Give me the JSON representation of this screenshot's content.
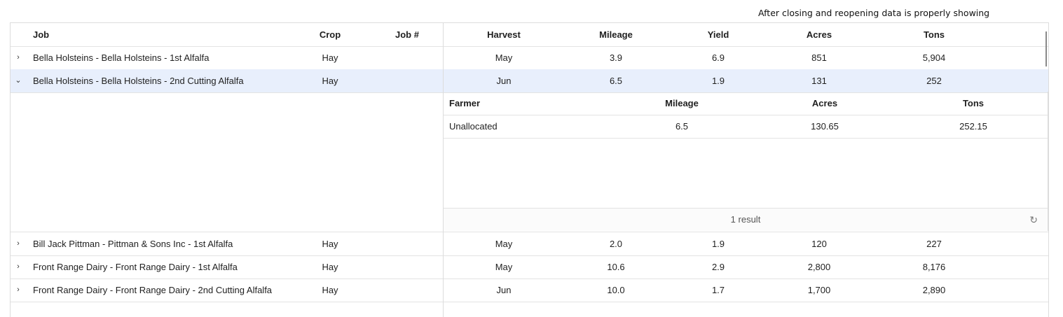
{
  "annotation": "After closing and reopening data is properly showing",
  "columns": {
    "job": "Job",
    "crop": "Crop",
    "job_no": "Job #",
    "harvest": "Harvest",
    "mileage": "Mileage",
    "yield": "Yield",
    "acres": "Acres",
    "tons": "Tons"
  },
  "rows": [
    {
      "expander": "›",
      "job": "Bella Holsteins - Bella Holsteins - 1st Alfalfa",
      "crop": "Hay",
      "job_no": "",
      "harvest": "May",
      "mileage": "3.9",
      "yield": "6.9",
      "acres": "851",
      "tons": "5,904"
    },
    {
      "expander": "⌄",
      "job": "Bella Holsteins - Bella Holsteins - 2nd Cutting Alfalfa",
      "crop": "Hay",
      "job_no": "",
      "harvest": "Jun",
      "mileage": "6.5",
      "yield": "1.9",
      "acres": "131",
      "tons": "252"
    },
    {
      "expander": "›",
      "job": "Bill Jack Pittman - Pittman & Sons Inc - 1st Alfalfa",
      "crop": "Hay",
      "job_no": "",
      "harvest": "May",
      "mileage": "2.0",
      "yield": "1.9",
      "acres": "120",
      "tons": "227"
    },
    {
      "expander": "›",
      "job": "Front Range Dairy - Front Range Dairy - 1st Alfalfa",
      "crop": "Hay",
      "job_no": "",
      "harvest": "May",
      "mileage": "10.6",
      "yield": "2.9",
      "acres": "2,800",
      "tons": "8,176"
    },
    {
      "expander": "›",
      "job": "Front Range Dairy - Front Range Dairy - 2nd Cutting Alfalfa",
      "crop": "Hay",
      "job_no": "",
      "harvest": "Jun",
      "mileage": "10.0",
      "yield": "1.7",
      "acres": "1,700",
      "tons": "2,890"
    }
  ],
  "detail": {
    "columns": {
      "farmer": "Farmer",
      "mileage": "Mileage",
      "acres": "Acres",
      "tons": "Tons"
    },
    "rows": [
      {
        "farmer": "Unallocated",
        "mileage": "6.5",
        "acres": "130.65",
        "tons": "252.15"
      }
    ],
    "footer": "1 result",
    "refresh_icon": "↻"
  }
}
